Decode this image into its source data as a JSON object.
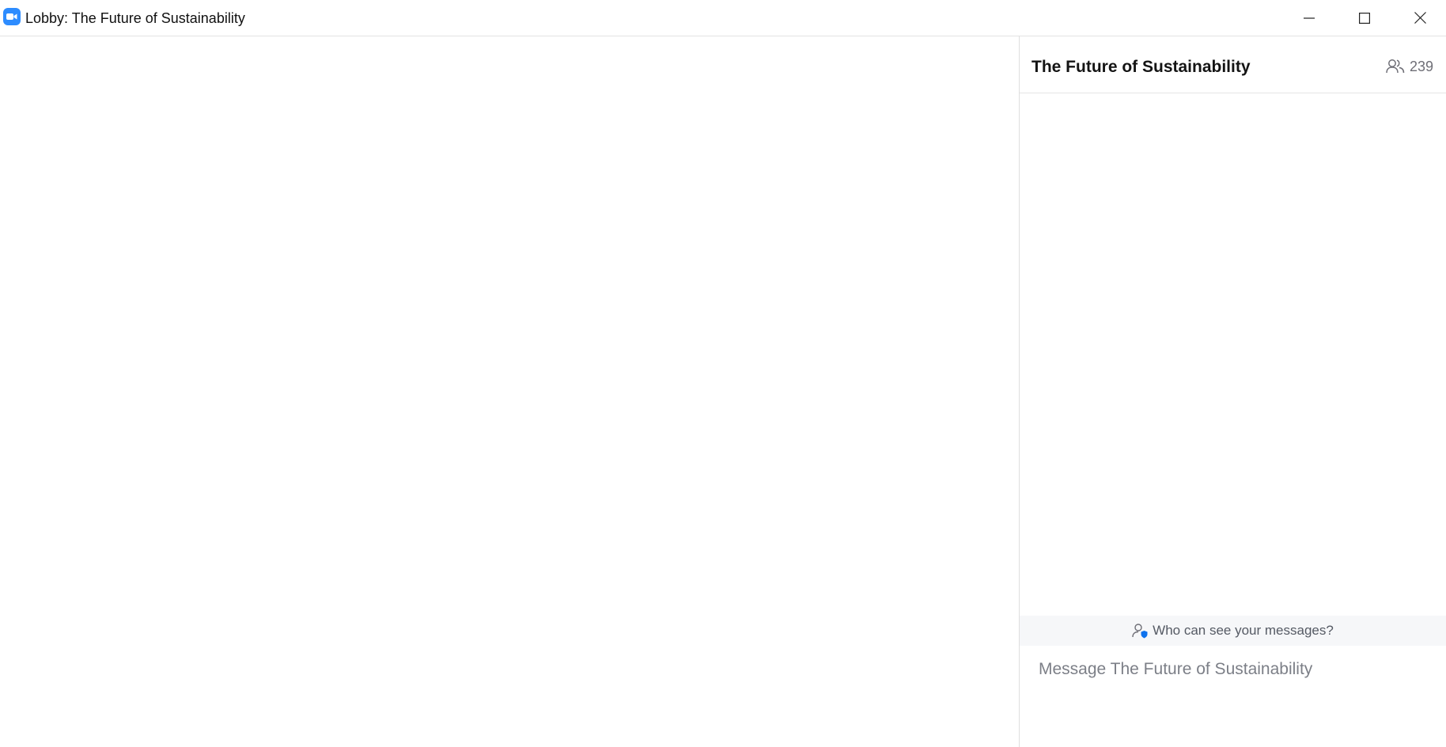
{
  "window": {
    "title": "Lobby: The Future of Sustainability",
    "app_icon": "zoom-video-camera-icon",
    "controls": [
      "minimize-icon",
      "maximize-icon",
      "close-icon"
    ]
  },
  "chat": {
    "title": "The Future of Sustainability",
    "participant_icon": "people-icon",
    "participant_count": "239",
    "privacy_link": "Who can see your messages?",
    "privacy_icon": "person-shield-icon",
    "input_placeholder": "Message The Future of Sustainability",
    "input_value": "",
    "emoji_icon": "smiley-icon",
    "send_icon": "send-icon"
  },
  "colors": {
    "brand": "#2d8cff",
    "privacy_bar_bg": "#f6f7f9",
    "muted_text": "#6e6e76"
  }
}
